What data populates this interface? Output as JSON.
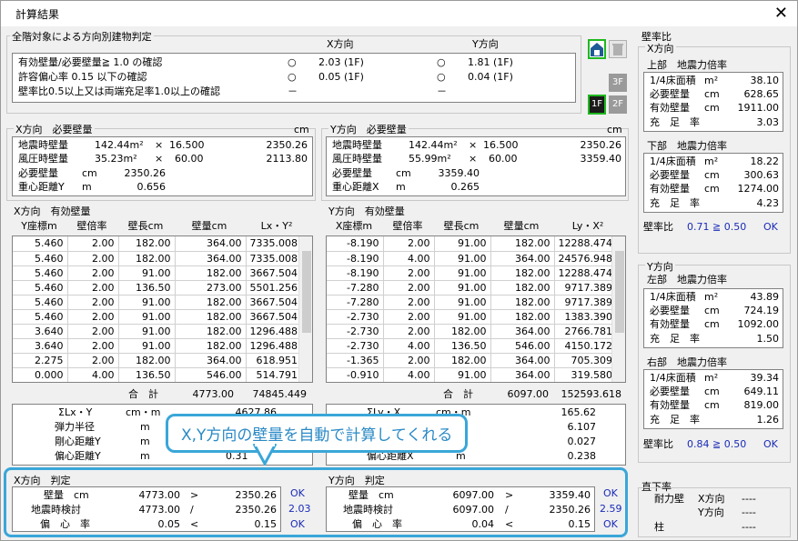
{
  "window": {
    "title": "計算結果",
    "close": "✕"
  },
  "judgement": {
    "title": "全階対象による方向別建物判定",
    "col_x": "X方向",
    "col_y": "Y方向",
    "rows": [
      {
        "label": "有効壁量/必要壁量≧ 1.0 の確認",
        "x_mark": "○",
        "x_val": "2.03 (1F)",
        "y_mark": "○",
        "y_val": "1.81 (1F)"
      },
      {
        "label": "許容偏心率 0.15 以下の確認",
        "x_mark": "○",
        "x_val": "0.05 (1F)",
        "y_mark": "○",
        "y_val": "0.04 (1F)"
      },
      {
        "label": "壁率比0.5以上又は両端充足率1.0以上の確認",
        "x_mark": "－",
        "x_val": "",
        "y_mark": "－",
        "y_val": ""
      }
    ]
  },
  "x_required": {
    "title": "X方向　必要壁量",
    "unit": "cm",
    "quake_label": "地震時壁量",
    "quake_area": "142.44m²",
    "quake_op": "×",
    "quake_factor": "16.500",
    "quake_total": "2350.26",
    "wind_label": "風圧時壁量",
    "wind_area": "35.23m²",
    "wind_op": "×",
    "wind_factor": "60.00",
    "wind_total": "2113.80",
    "req_label": "必要壁量",
    "req_unit": "cm",
    "req_value": "2350.26",
    "cog_label": "重心距離Y",
    "cog_unit": "m",
    "cog_value": "0.656"
  },
  "y_required": {
    "title": "Y方向　必要壁量",
    "unit": "cm",
    "quake_label": "地震時壁量",
    "quake_area": "142.44m²",
    "quake_op": "×",
    "quake_factor": "16.500",
    "quake_total": "2350.26",
    "wind_label": "風圧時壁量",
    "wind_area": "55.99m²",
    "wind_op": "×",
    "wind_factor": "60.00",
    "wind_total": "3359.40",
    "req_label": "必要壁量",
    "req_unit": "cm",
    "req_value": "3359.40",
    "cog_label": "重心距離X",
    "cog_unit": "m",
    "cog_value": "0.265"
  },
  "x_effective": {
    "title": "X方向　有効壁量",
    "headers": [
      "Y座標m",
      "壁倍率",
      "壁長cm",
      "壁量cm",
      "Lx・Y²"
    ],
    "rows": [
      [
        "5.460",
        "2.00",
        "182.00",
        "364.00",
        "7335.008"
      ],
      [
        "5.460",
        "2.00",
        "182.00",
        "364.00",
        "7335.008"
      ],
      [
        "5.460",
        "2.00",
        "91.00",
        "182.00",
        "3667.504"
      ],
      [
        "5.460",
        "2.00",
        "136.50",
        "273.00",
        "5501.256"
      ],
      [
        "5.460",
        "2.00",
        "91.00",
        "182.00",
        "3667.504"
      ],
      [
        "5.460",
        "2.00",
        "91.00",
        "182.00",
        "3667.504"
      ],
      [
        "3.640",
        "2.00",
        "91.00",
        "182.00",
        "1296.488"
      ],
      [
        "3.640",
        "2.00",
        "91.00",
        "182.00",
        "1296.488"
      ],
      [
        "2.275",
        "2.00",
        "182.00",
        "364.00",
        "618.951"
      ],
      [
        "0.000",
        "4.00",
        "136.50",
        "546.00",
        "514.791"
      ]
    ],
    "total_label": "合　計",
    "total_wall": "4773.00",
    "total_lx": "74845.449",
    "sum_label": "ΣLx・Y",
    "sum_unit": "cm・m",
    "sum_value": "4627.86",
    "elastic_label": "弾力半径",
    "elastic_unit": "m",
    "stiff_label": "剛心距離Y",
    "stiff_unit": "m",
    "ecc_label": "偏心距離Y",
    "ecc_unit": "m",
    "ecc_value": "0.31"
  },
  "y_effective": {
    "title": "Y方向　有効壁量",
    "headers": [
      "X座標m",
      "壁倍率",
      "壁長cm",
      "壁量cm",
      "Ly・X²"
    ],
    "rows": [
      [
        "-8.190",
        "2.00",
        "91.00",
        "182.00",
        "12288.474"
      ],
      [
        "-8.190",
        "4.00",
        "91.00",
        "364.00",
        "24576.948"
      ],
      [
        "-8.190",
        "2.00",
        "91.00",
        "182.00",
        "12288.474"
      ],
      [
        "-7.280",
        "2.00",
        "91.00",
        "182.00",
        "9717.389"
      ],
      [
        "-7.280",
        "2.00",
        "91.00",
        "182.00",
        "9717.389"
      ],
      [
        "-2.730",
        "2.00",
        "91.00",
        "182.00",
        "1383.390"
      ],
      [
        "-2.730",
        "2.00",
        "182.00",
        "364.00",
        "2766.781"
      ],
      [
        "-2.730",
        "4.00",
        "136.50",
        "546.00",
        "4150.172"
      ],
      [
        "-1.365",
        "2.00",
        "182.00",
        "364.00",
        "705.309"
      ],
      [
        "-0.910",
        "4.00",
        "91.00",
        "364.00",
        "319.580"
      ]
    ],
    "total_label": "合　計",
    "total_wall": "6097.00",
    "total_ly": "152593.618",
    "sum_label": "ΣLy・X",
    "sum_unit": "cm・m",
    "sum_value": "165.62",
    "elastic_value": "6.107",
    "stiff_value": "0.027",
    "ecc_label": "偏心距離X",
    "ecc_unit": "m",
    "ecc_value": "0.238"
  },
  "callout": "X,Y方向の壁量を自動で計算してくれる",
  "x_judge": {
    "title": "X方向　判定",
    "row1": {
      "label": "壁量　cm",
      "a": "4773.00",
      "op": ">",
      "b": "2350.26",
      "res": "OK"
    },
    "row2": {
      "label": "地震時検討",
      "a": "4773.00",
      "op": "/",
      "b": "2350.26",
      "res": "2.03"
    },
    "row3": {
      "label": "偏　心　率",
      "a": "0.05",
      "op": "<",
      "b": "0.15",
      "res": "OK"
    }
  },
  "y_judge": {
    "title": "Y方向　判定",
    "row1": {
      "label": "壁量　cm",
      "a": "6097.00",
      "op": ">",
      "b": "3359.40",
      "res": "OK"
    },
    "row2": {
      "label": "地震時検討",
      "a": "6097.00",
      "op": "/",
      "b": "2350.26",
      "res": "2.59"
    },
    "row3": {
      "label": "偏　心　率",
      "a": "0.04",
      "op": "<",
      "b": "0.15",
      "res": "OK"
    }
  },
  "wall_ratio": {
    "title": "壁率比",
    "x_dir": "X方向",
    "upper": {
      "title": "上部　地震力倍率",
      "l1": "1/4床面積",
      "u1": "m²",
      "v1": "38.10",
      "l2": "必要壁量",
      "u2": "cm",
      "v2": "628.65",
      "l3": "有効壁量",
      "u3": "cm",
      "v3": "1911.00",
      "l4": "充　足　率",
      "v4": "3.03"
    },
    "lower": {
      "title": "下部　地震力倍率",
      "l1": "1/4床面積",
      "u1": "m²",
      "v1": "18.22",
      "l2": "必要壁量",
      "u2": "cm",
      "v2": "300.63",
      "l3": "有効壁量",
      "u3": "cm",
      "v3": "1274.00",
      "l4": "充　足　率",
      "v4": "4.23"
    },
    "x_ratio_label": "壁率比",
    "x_ratio": "0.71 ≧ 0.50",
    "x_ratio_res": "OK",
    "y_dir": "Y方向",
    "left": {
      "title": "左部　地震力倍率",
      "l1": "1/4床面積",
      "u1": "m²",
      "v1": "43.89",
      "l2": "必要壁量",
      "u2": "cm",
      "v2": "724.19",
      "l3": "有効壁量",
      "u3": "cm",
      "v3": "1092.00",
      "l4": "充　足　率",
      "v4": "1.50"
    },
    "right": {
      "title": "右部　地震力倍率",
      "l1": "1/4床面積",
      "u1": "m²",
      "v1": "39.34",
      "l2": "必要壁量",
      "u2": "cm",
      "v2": "649.11",
      "l3": "有効壁量",
      "u3": "cm",
      "v3": "819.00",
      "l4": "充　足　率",
      "v4": "1.26"
    },
    "y_ratio_label": "壁率比",
    "y_ratio": "0.84 ≧ 0.50",
    "y_ratio_res": "OK"
  },
  "direct": {
    "title": "直下率",
    "wall": "耐力壁",
    "x": "X方向",
    "y": "Y方向",
    "col": "柱",
    "xv": "----",
    "yv": "----",
    "cv": "----"
  },
  "floors": {
    "f3": "3F",
    "f2": "2F",
    "f1": "1F"
  }
}
